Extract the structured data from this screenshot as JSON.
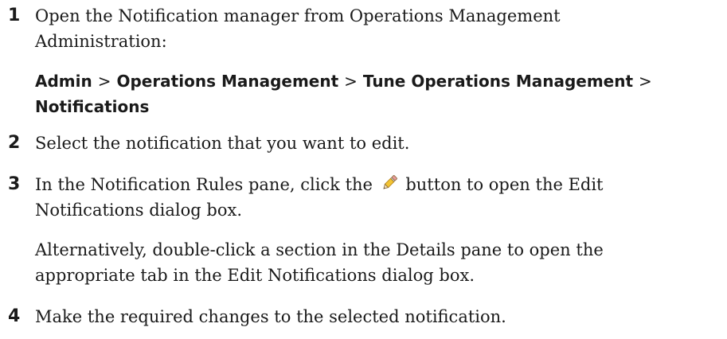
{
  "steps": [
    {
      "number": "1",
      "text_line1": "Open the Notification manager from Operations Management",
      "text_line2": "Administration:"
    },
    {
      "number": "2",
      "text": "Select the notification that you want to edit."
    },
    {
      "number": "3",
      "text_before_icon": "In the Notification Rules pane, click the",
      "icon": "pencil-edit-icon",
      "text_after_icon": "button to open the Edit",
      "text_line2": "Notifications dialog box.",
      "alt_line1": "Alternatively, double-click a section in the Details pane to open the",
      "alt_line2": "appropriate tab in the Edit Notifications dialog box."
    },
    {
      "number": "4",
      "text": "Make the required changes to the selected notification."
    }
  ],
  "menu_path": {
    "items": [
      "Admin",
      "Operations Management",
      "Tune Operations Management",
      "Notifications"
    ],
    "separator": ">"
  }
}
